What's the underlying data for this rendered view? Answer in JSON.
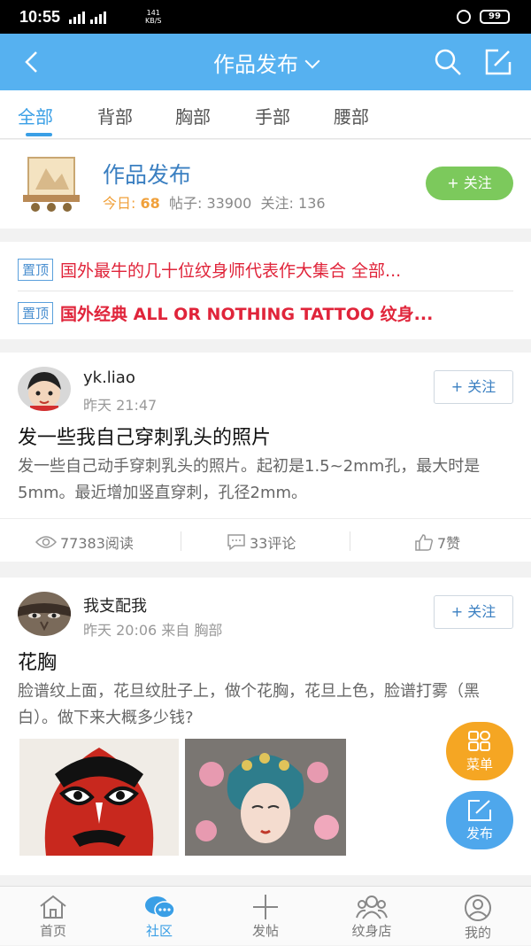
{
  "status": {
    "time": "10:55",
    "speed_value": "141",
    "speed_unit": "KB/S",
    "battery": "99"
  },
  "topbar": {
    "title": "作品发布"
  },
  "tabs": [
    "全部",
    "背部",
    "胸部",
    "手部",
    "腰部"
  ],
  "forum": {
    "name": "作品发布",
    "today_label": "今日:",
    "today_value": "68",
    "posts_label": "帖子:",
    "posts_value": "33900",
    "follows_label": "关注:",
    "follows_value": "136",
    "follow_label": "+ 关注"
  },
  "pinned": [
    {
      "tag": "置顶",
      "text": "国外最牛的几十位纹身师代表作大集合 全部..."
    },
    {
      "tag": "置顶",
      "text": "国外经典  ALL OR NOTHING TATTOO 纹身..."
    }
  ],
  "posts": [
    {
      "user": "yk.liao",
      "time": "昨天 21:47",
      "follow_label": "+ 关注",
      "title": "发一些我自己穿刺乳头的照片",
      "body": "发一些自己动手穿刺乳头的照片。起初是1.5~2mm孔，最大时是5mm。最近增加竖直穿刺，孔径2mm。",
      "views": "77383阅读",
      "comments": "33评论",
      "likes": "7赞"
    },
    {
      "user": "我支配我",
      "time": "昨天 20:06  来自 胸部",
      "follow_label": "+ 关注",
      "title": "花胸",
      "body": "脸谱纹上面，花旦纹肚子上，做个花胸，花旦上色，脸谱打雾（黑白）。做下来大概多少钱?"
    }
  ],
  "fab": {
    "menu": "菜单",
    "post": "发布"
  },
  "nav": [
    "首页",
    "社区",
    "发帖",
    "纹身店",
    "我的"
  ],
  "colors": {
    "primary": "#56b1f0",
    "accent": "#3a9fe6",
    "pin_red": "#e0243a",
    "follow_green": "#7cc95c",
    "fab_orange": "#f5a623"
  }
}
